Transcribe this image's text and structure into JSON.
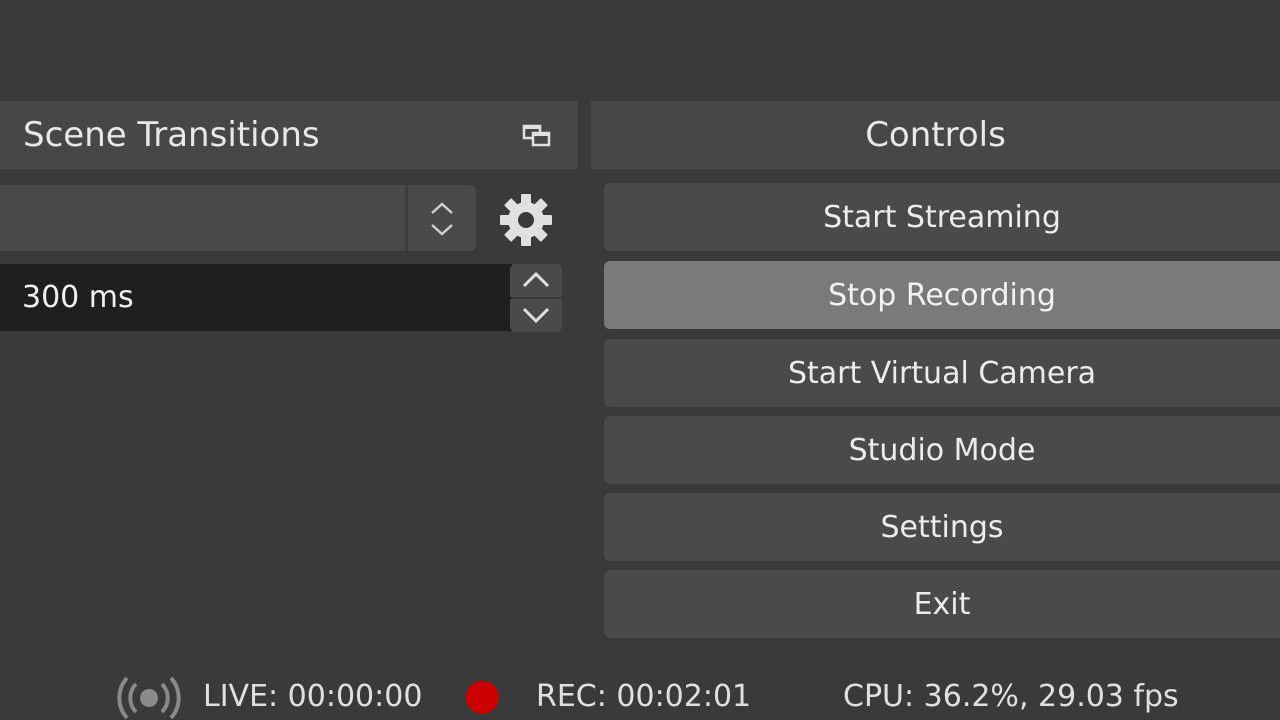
{
  "scene_transitions": {
    "title": "Scene Transitions",
    "float_icon": "undock-icon",
    "transition_select": {
      "value": "",
      "arrows_icon": "updown-chevron-icon"
    },
    "settings_icon": "gear-icon",
    "duration": {
      "value": "300 ms",
      "up_icon": "chevron-up-icon",
      "down_icon": "chevron-down-icon"
    }
  },
  "controls": {
    "title": "Controls",
    "buttons": [
      {
        "label": "Start Streaming",
        "active": false
      },
      {
        "label": "Stop Recording",
        "active": true
      },
      {
        "label": "Start Virtual Camera",
        "active": false
      },
      {
        "label": "Studio Mode",
        "active": false
      },
      {
        "label": "Settings",
        "active": false
      },
      {
        "label": "Exit",
        "active": false
      }
    ]
  },
  "status_bar": {
    "live_icon": "broadcast-icon",
    "live": "LIVE: 00:00:00",
    "rec_icon": "record-dot-icon",
    "rec_color": "#cc0000",
    "rec": "REC: 00:02:01",
    "cpu": "CPU: 36.2%, 29.03 fps"
  },
  "colors": {
    "background": "#3a3a3a",
    "panel_header": "#474747",
    "button": "#4a4a4a",
    "button_active": "#7a7a7a",
    "input_dark": "#1f1f1f"
  }
}
